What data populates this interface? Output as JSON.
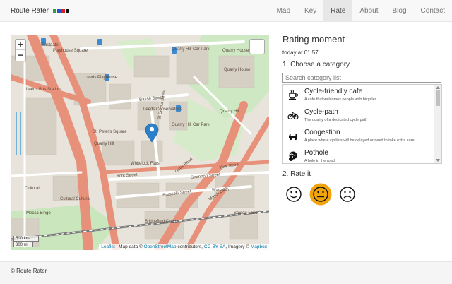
{
  "brand": {
    "name": "Route Rater",
    "square_colors": [
      "#2e9e3d",
      "#2255cc",
      "#d62222",
      "#111111"
    ]
  },
  "nav": {
    "items": [
      {
        "label": "Map",
        "active": false
      },
      {
        "label": "Key",
        "active": false
      },
      {
        "label": "Rate",
        "active": true
      },
      {
        "label": "About",
        "active": false
      },
      {
        "label": "Blog",
        "active": false
      },
      {
        "label": "Contact",
        "active": false
      }
    ]
  },
  "map": {
    "zoom_in": "+",
    "zoom_out": "−",
    "scale_metric": "500 km",
    "scale_imperial": "300 mi",
    "attribution": {
      "leaflet": "Leaflet",
      "text1": " | Map data © ",
      "osm": "OpenStreetMap",
      "text2": " contributors, ",
      "ccbysa": "CC-BY-SA",
      "text3": ", Imagery © ",
      "mapbox": "Mapbox"
    },
    "labels": [
      "Eastgate",
      "Playhouse Square",
      "Leeds Playhouse",
      "Quarry Hill Car Park",
      "Quarry House",
      "Quarry House",
      "Leeds Bus Station",
      "Leeds Conservatoire",
      "Quarry Hill Car Park",
      "Quarry Hill",
      "St. Peter's Square",
      "Quarry Hill",
      "Whitelock Flats",
      "Basse Street",
      "St Cecilia Street",
      "York Street",
      "York Street",
      "Brussels Street",
      "Cultural",
      "Cultural Cultural",
      "Marsh Lane",
      "Saxton Lane",
      "Mecca Bingo",
      "Shannon Street",
      "Gotts Road",
      "Waterloo",
      "Bridgefield Court"
    ],
    "pin_color": "#2a81cb"
  },
  "panel": {
    "title": "Rating moment",
    "time": "today at 01:57",
    "step1": "1. Choose a category",
    "search_placeholder": "Search category list",
    "categories": [
      {
        "name": "Cycle-friendly cafe",
        "desc": "A cafe that welcomes people with bicycles",
        "icon": "coffee-cup-icon"
      },
      {
        "name": "Cycle-path",
        "desc": "The quality of a dedicated cycle path",
        "icon": "bicycle-icon"
      },
      {
        "name": "Congestion",
        "desc": "A place where cyclists will be delayed or need to take extra care",
        "icon": "car-icon"
      },
      {
        "name": "Pothole",
        "desc": "A hole in the road",
        "icon": "pothole-icon"
      }
    ],
    "step2": "2. Rate it",
    "ratings": [
      {
        "name": "good",
        "icon": "smile-face-icon",
        "selected": false
      },
      {
        "name": "neutral",
        "icon": "neutral-face-icon",
        "selected": true
      },
      {
        "name": "bad",
        "icon": "frown-face-icon",
        "selected": false
      }
    ],
    "selected_color": "#f0a30a"
  },
  "footer": {
    "text": "© Route Rater"
  }
}
